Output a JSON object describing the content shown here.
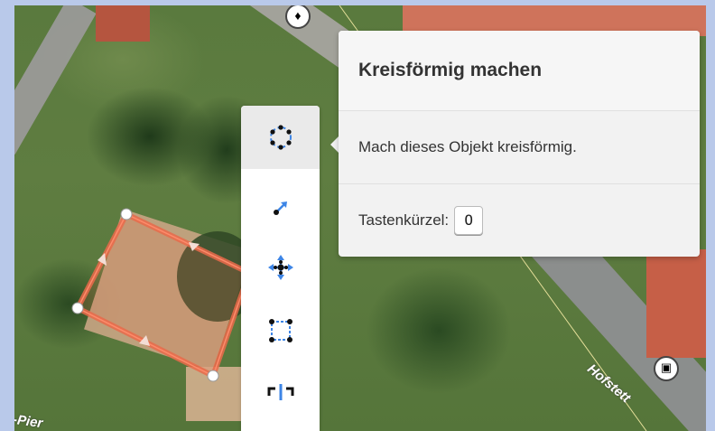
{
  "tooltip": {
    "title": "Kreisförmig machen",
    "description": "Mach dieses Objekt kreisförmig.",
    "shortcut_label": "Tastenkürzel:",
    "shortcut_key": "O"
  },
  "toolbar": {
    "items": [
      {
        "name": "circularize",
        "icon": "circularize-icon",
        "active": true
      },
      {
        "name": "extract",
        "icon": "extract-icon"
      },
      {
        "name": "move",
        "icon": "move-icon"
      },
      {
        "name": "square",
        "icon": "square-icon"
      },
      {
        "name": "reflect",
        "icon": "reflect-icon"
      }
    ]
  },
  "map_labels": {
    "street_right": "Hofstett",
    "street_left": "-Pier"
  },
  "colors": {
    "selection": "#e96a4a",
    "tool_blue": "#3d85e6",
    "tooltip_bg": "#f2f2f2"
  }
}
